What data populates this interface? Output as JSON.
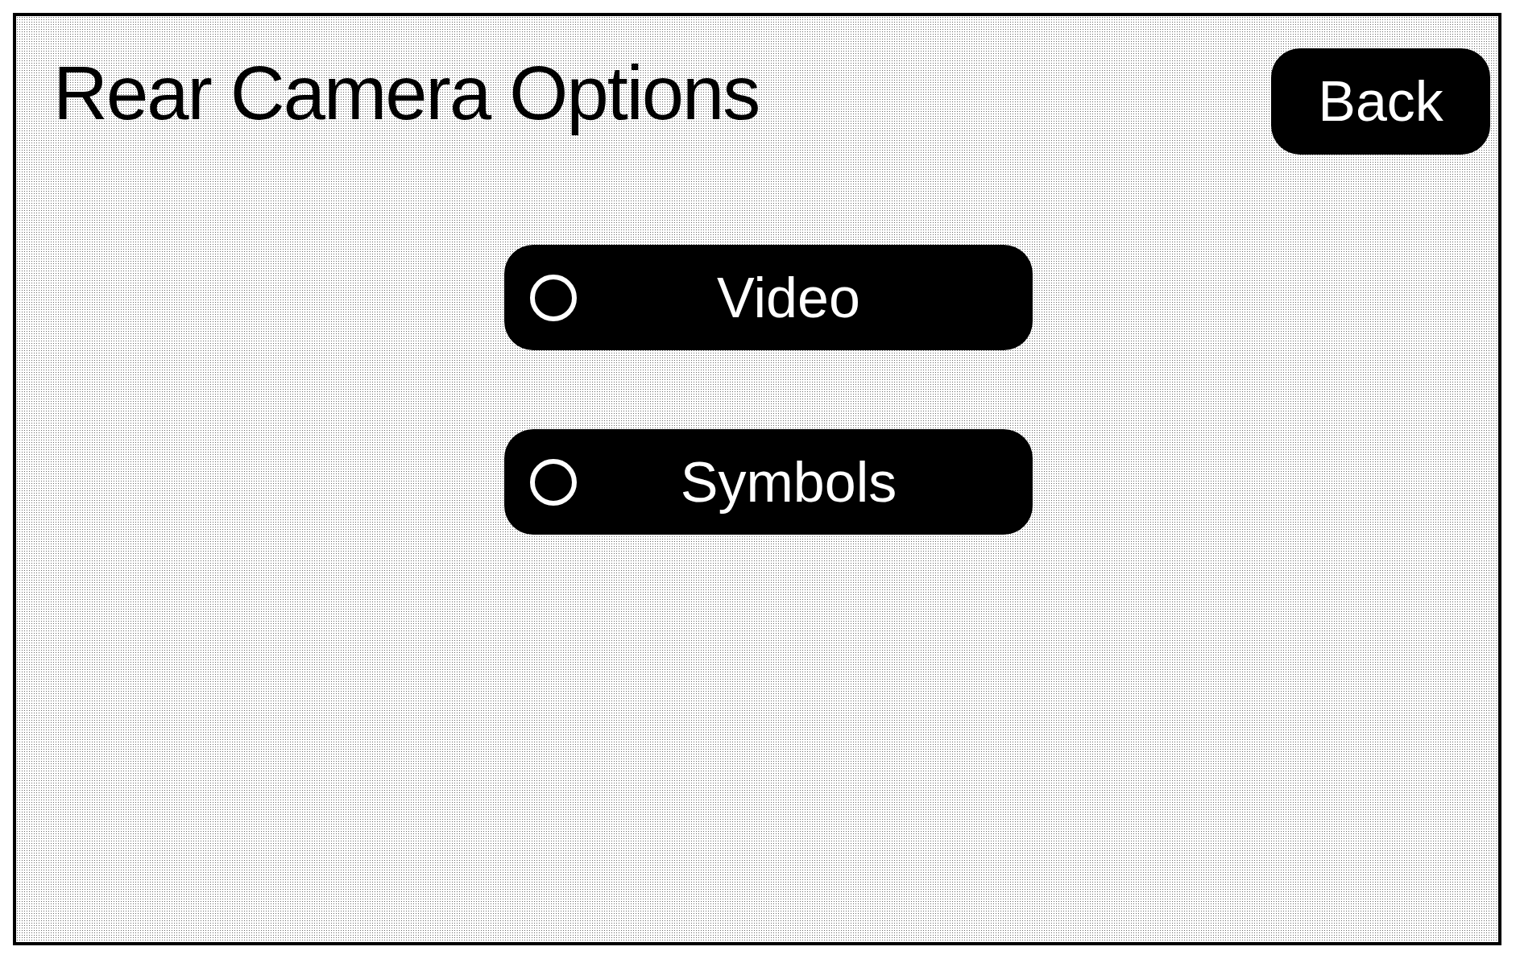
{
  "title": "Rear Camera Options",
  "back_button": {
    "label": "Back"
  },
  "options": [
    {
      "label": "Video",
      "selected": false
    },
    {
      "label": "Symbols",
      "selected": false
    }
  ]
}
